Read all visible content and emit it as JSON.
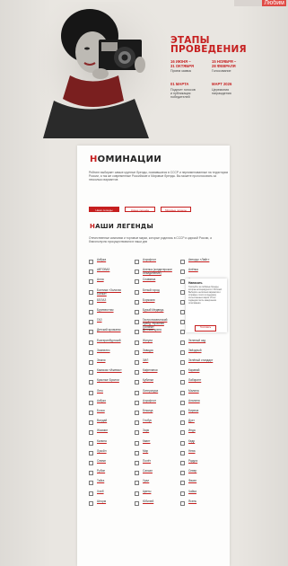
{
  "top_tag": "Любим",
  "stages": {
    "title_line1": "ЭТАПЫ",
    "title_line2": "ПРОВЕДЕНИЯ",
    "items": [
      {
        "date": "16 ИЮНЯ –\n31 ОКТЯБРЯ",
        "text": "Прием заявок"
      },
      {
        "date": "15 НОЯБРЯ –\n28 ФЕВРАЛЯ",
        "text": "Голосование"
      },
      {
        "date": "01 МАРТА",
        "text": "Подсчет голосов\nи публикация\nпобедителей"
      },
      {
        "date": "МАРТ 2026",
        "text": "Церемония\nнаграждения"
      }
    ]
  },
  "nominations": {
    "title_first": "Н",
    "title_rest": "ОМИНАЦИИ",
    "description": "Рейтинг выбирает самые крупные бренды, появившиеся в СССР и переименованные на территории России, а так же современные Российские и Мировые бренды. Вы можете проголосовать за несколько вариантов",
    "tabs": [
      "Наши легенды",
      "Новые легенды",
      "Мировые легенды"
    ]
  },
  "legends": {
    "title_first": "Н",
    "title_rest": "АШИ ЛЕГЕНДЫ",
    "description": "Отечественные компании и торговые марки, которые родились в СССР и царской России, а благополучно просуществовали в наши дни",
    "brands": [
      "Азбука",
      "Аэрофлот",
      "Авторус «Лайт»",
      "АВТОВАЗ",
      "Аленка (кондитерское объединение)",
      "Алёнка",
      "Алла",
      "Славянка",
      "Артек",
      "Балтика «Золотая Балка»",
      "Белый город",
      "Бабаевский",
      "БЕЛАЗ",
      "Боржоми",
      "Благо",
      "Буревестник",
      "Бурый Медведь",
      "Ваниль",
      "ГАЗ",
      "Гастрономический бренд «Красная Поляна»",
      "Главная",
      "Детский ароматик",
      "Детская кухня",
      "Дом обуви",
      "Екатеринбургский",
      "Жигули",
      "Зеленый сад",
      "Зимнелес",
      "Заводск",
      "Звёздный",
      "Земля",
      "ЗИЛ",
      "Зелёный стандарт",
      "Камская «Ижевск»",
      "Кафелинки",
      "Каравай",
      "Красные Брилли",
      "Кубинки",
      "Лабиринт",
      "Лето",
      "Литература",
      "Малина",
      "Азбуко",
      "Аэрофлот",
      "Альпина",
      "Бочка",
      "Бежица",
      "Бирюза",
      "Валдай",
      "Глобус",
      "Дуэт",
      "Жасмин",
      "Заря",
      "Инда",
      "Калина",
      "Квант",
      "Кедр",
      "Лукойл",
      "Мир",
      "Нева",
      "Олимп",
      "Полёт",
      "Радуга",
      "Рубин",
      "Сапсан",
      "Север",
      "Тайга",
      "Урал",
      "Факел",
      "Хлеб",
      "Цветы",
      "Чайка",
      "Шторм",
      "Юбилей",
      "Ясень"
    ]
  },
  "popup": {
    "title": "Написать",
    "body": "Голосуйте за любимые бренды, которые ассоциируются с Россией. Выберите несколько вариантов и отправьте голос в поддержку отечественных марок. Итоги подведём после завершения голосования.",
    "button": "Голосовать"
  }
}
